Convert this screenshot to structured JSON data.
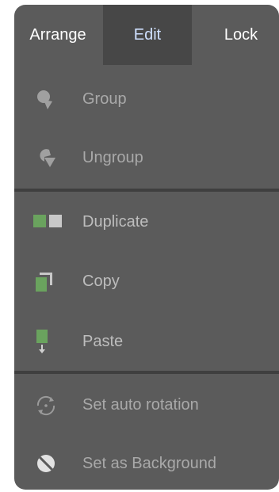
{
  "tabs": [
    {
      "label": "Arrange"
    },
    {
      "label": "Edit"
    },
    {
      "label": "Lock"
    }
  ],
  "selected_tab": "Edit",
  "menu": {
    "group": {
      "label": "Group",
      "icon": "group-icon"
    },
    "ungroup": {
      "label": "Ungroup",
      "icon": "ungroup-icon"
    },
    "duplicate": {
      "label": "Duplicate",
      "icon": "duplicate-icon"
    },
    "copy": {
      "label": "Copy",
      "icon": "copy-icon"
    },
    "paste": {
      "label": "Paste",
      "icon": "paste-icon"
    },
    "auto_rotation": {
      "label": "Set auto rotation",
      "icon": "rotation-icon"
    },
    "background": {
      "label": "Set as Background",
      "icon": "background-icon"
    }
  },
  "colors": {
    "panel": "#5b5b5b",
    "selected_tab": "#474747",
    "selected_tab_text": "#cfe0ff",
    "green_accent": "#6aa35e",
    "disabled_text": "#a9a9a9"
  }
}
